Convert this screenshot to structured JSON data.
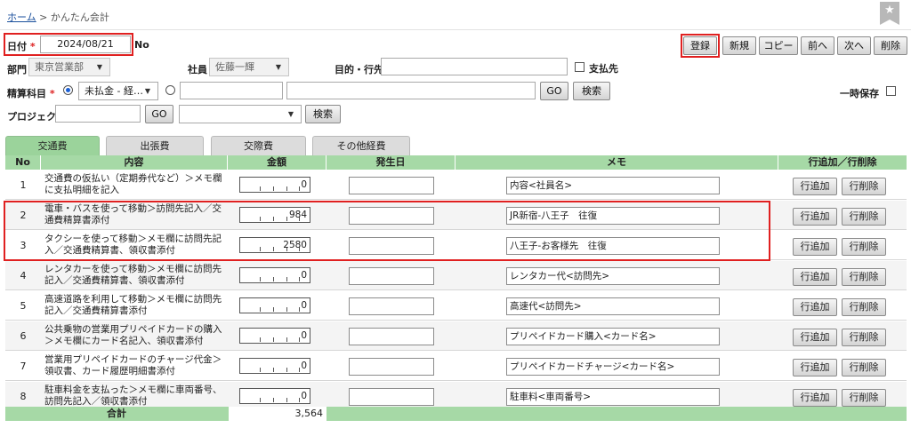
{
  "breadcrumb": {
    "home": "ホーム",
    "separator": ">",
    "current": "かんたん会計"
  },
  "header": {
    "date_label": "日付",
    "required_mark": "*",
    "date_value": "2024/08/21",
    "no_label": "No",
    "dept_label": "部門",
    "dept_value": "東京営業部",
    "employee_label": "社員",
    "employee_value": "佐藤一輝",
    "purpose_label": "目的・行先",
    "purpose_value": "",
    "payment_label": "支払先",
    "account_label": "精算科目",
    "account_value": "未払金 - 経…",
    "project_label": "プロジェクト",
    "hold_label": "一時保存"
  },
  "buttons": {
    "register": "登録",
    "new": "新規",
    "copy": "コピー",
    "prev": "前へ",
    "next": "次へ",
    "delete": "削除",
    "go": "GO",
    "search": "検索"
  },
  "tabs": [
    {
      "label": "交通費"
    },
    {
      "label": "出張費"
    },
    {
      "label": "交際費"
    },
    {
      "label": "その他経費"
    }
  ],
  "table": {
    "columns": [
      "No",
      "内容",
      "金額",
      "発生日",
      "メモ",
      "行追加／行削除"
    ],
    "add_label": "行追加",
    "del_label": "行削除",
    "rows": [
      {
        "no": "1",
        "content": "交通費の仮払い（定期券代など）＞メモ欄に支払明細を記入",
        "amount": "0",
        "date": "",
        "memo": "内容<社員名>"
      },
      {
        "no": "2",
        "content": "電車・バスを使って移動＞訪問先記入／交通費精算書添付",
        "amount": "984",
        "date": "",
        "memo": "JR新宿-八王子　往復"
      },
      {
        "no": "3",
        "content": "タクシーを使って移動＞メモ欄に訪問先記入／交通費精算書、領収書添付",
        "amount": "2580",
        "date": "",
        "memo": "八王子-お客様先　往復"
      },
      {
        "no": "4",
        "content": "レンタカーを使って移動＞メモ欄に訪問先記入／交通費精算書、領収書添付",
        "amount": "0",
        "date": "",
        "memo": "レンタカー代<訪問先>"
      },
      {
        "no": "5",
        "content": "高速道路を利用して移動＞メモ欄に訪問先記入／交通費精算書添付",
        "amount": "0",
        "date": "",
        "memo": "高速代<訪問先>"
      },
      {
        "no": "6",
        "content": "公共乗物の営業用プリペイドカードの購入＞メモ欄にカード名記入、領収書添付",
        "amount": "0",
        "date": "",
        "memo": "プリペイドカード購入<カード名>"
      },
      {
        "no": "7",
        "content": "営業用プリペイドカードのチャージ代金＞領収書、カード履歴明細書添付",
        "amount": "0",
        "date": "",
        "memo": "プリペイドカードチャージ<カード名>"
      },
      {
        "no": "8",
        "content": "駐車料金を支払った＞メモ欄に車両番号、訪問先記入／領収書添付",
        "amount": "0",
        "date": "",
        "memo": "駐車料<車両番号>"
      }
    ],
    "total_label": "合計",
    "total_value": "3,564"
  },
  "colors": {
    "accent_green": "#a6d9a6",
    "tab_active": "#9bd39b",
    "highlight_red": "#e02020",
    "link_blue": "#1a4f9c"
  },
  "icons": {
    "favorite": "star-icon",
    "dropdown": "chevron-down-icon"
  }
}
